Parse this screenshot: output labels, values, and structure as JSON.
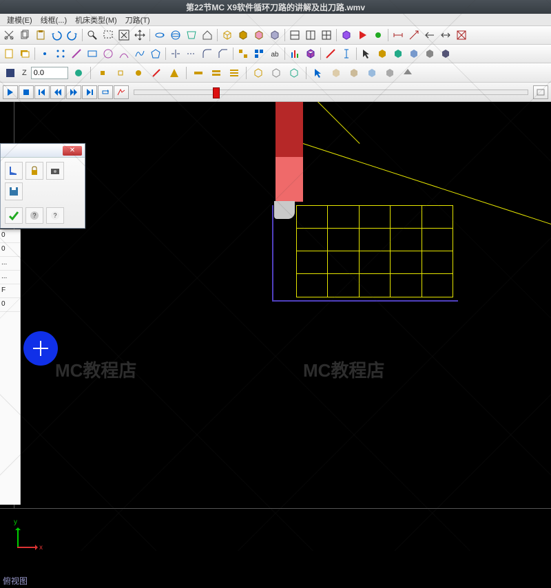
{
  "title": "第22节MC X9软件循环刀路的讲解及出刀路.wmv",
  "menu": [
    "建模(E)",
    "线框(...)",
    "机床类型(M)",
    "刀路(T)"
  ],
  "coord": {
    "z_label": "Z",
    "z_value": "0.0"
  },
  "left_panel": [
    "0",
    "0",
    "...",
    "...",
    "F",
    "0"
  ],
  "watermark_text": "MC教程店",
  "status_text": "俯视图",
  "axis": {
    "x": "x",
    "y": "y"
  }
}
